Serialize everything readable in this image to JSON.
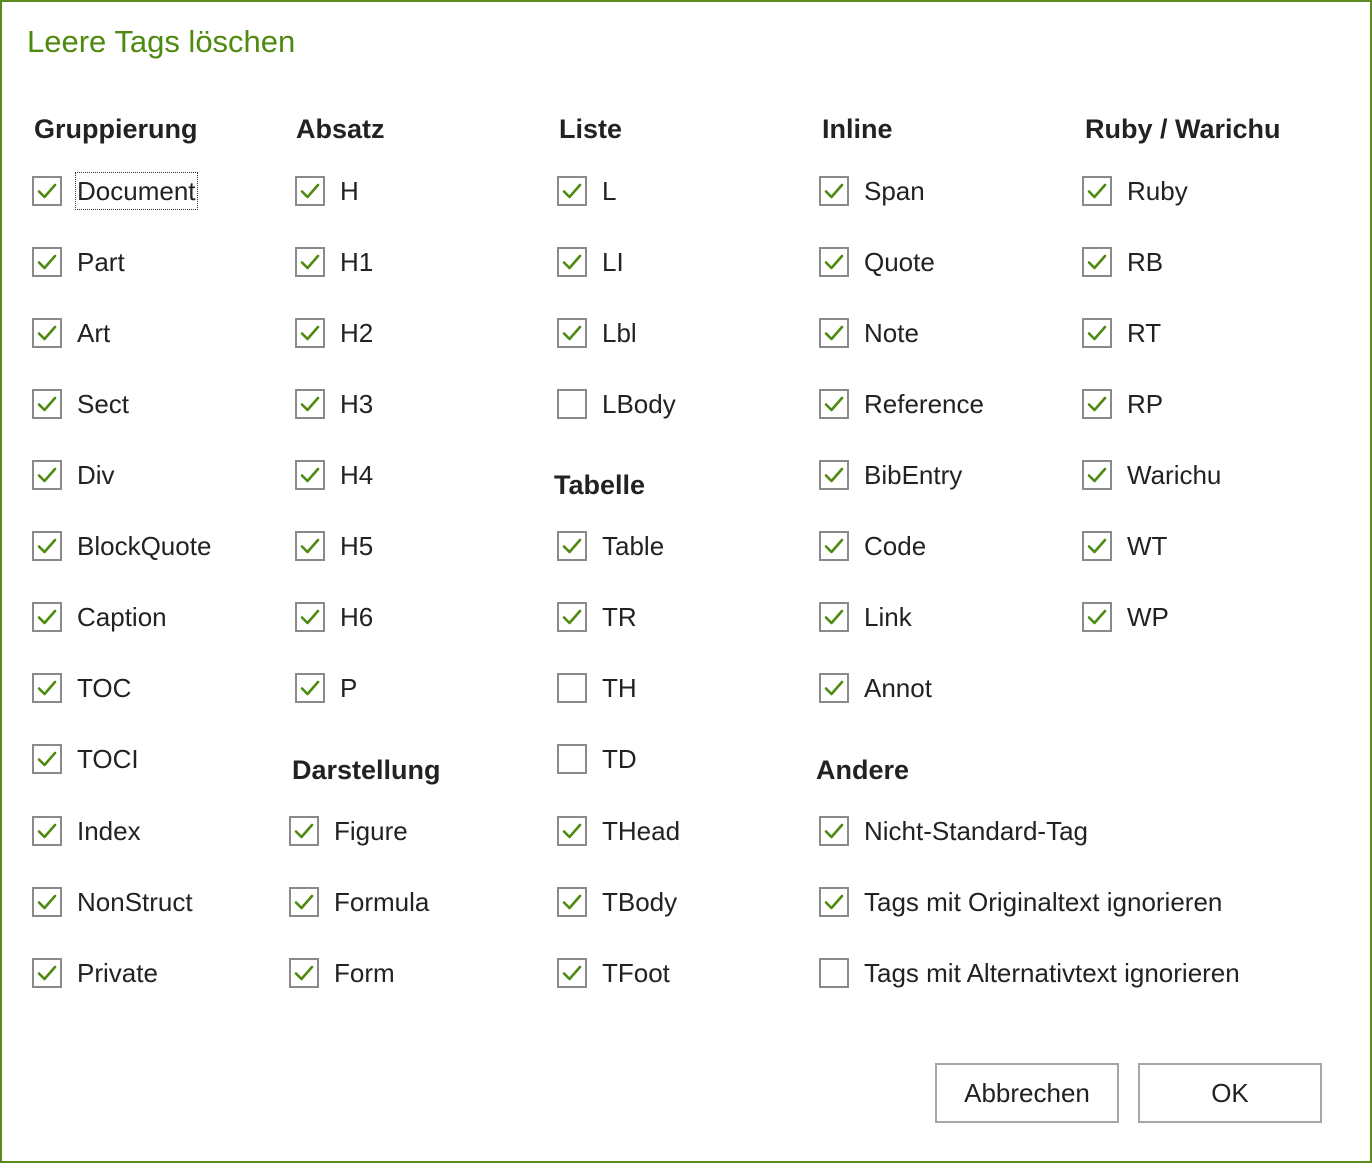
{
  "dialog": {
    "title": "Leere Tags löschen"
  },
  "headings": {
    "gruppierung": "Gruppierung",
    "absatz": "Absatz",
    "liste": "Liste",
    "inline": "Inline",
    "ruby": "Ruby / Warichu",
    "tabelle": "Tabelle",
    "darstellung": "Darstellung",
    "andere": "Andere"
  },
  "columns": {
    "gruppierung": [
      {
        "label": "Document",
        "checked": true
      },
      {
        "label": "Part",
        "checked": true
      },
      {
        "label": "Art",
        "checked": true
      },
      {
        "label": "Sect",
        "checked": true
      },
      {
        "label": "Div",
        "checked": true
      },
      {
        "label": "BlockQuote",
        "checked": true
      },
      {
        "label": "Caption",
        "checked": true
      },
      {
        "label": "TOC",
        "checked": true
      },
      {
        "label": "TOCI",
        "checked": true
      },
      {
        "label": "Index",
        "checked": true
      },
      {
        "label": "NonStruct",
        "checked": true
      },
      {
        "label": "Private",
        "checked": true
      }
    ],
    "absatz": [
      {
        "label": "H",
        "checked": true
      },
      {
        "label": "H1",
        "checked": true
      },
      {
        "label": "H2",
        "checked": true
      },
      {
        "label": "H3",
        "checked": true
      },
      {
        "label": "H4",
        "checked": true
      },
      {
        "label": "H5",
        "checked": true
      },
      {
        "label": "H6",
        "checked": true
      },
      {
        "label": "P",
        "checked": true
      }
    ],
    "darstellung": [
      {
        "label": "Figure",
        "checked": true
      },
      {
        "label": "Formula",
        "checked": true
      },
      {
        "label": "Form",
        "checked": true
      }
    ],
    "liste": [
      {
        "label": "L",
        "checked": true
      },
      {
        "label": "LI",
        "checked": true
      },
      {
        "label": "Lbl",
        "checked": true
      },
      {
        "label": "LBody",
        "checked": false
      }
    ],
    "tabelle": [
      {
        "label": "Table",
        "checked": true
      },
      {
        "label": "TR",
        "checked": true
      },
      {
        "label": "TH",
        "checked": false
      },
      {
        "label": "TD",
        "checked": false
      },
      {
        "label": "THead",
        "checked": true
      },
      {
        "label": "TBody",
        "checked": true
      },
      {
        "label": "TFoot",
        "checked": true
      }
    ],
    "inline": [
      {
        "label": "Span",
        "checked": true
      },
      {
        "label": "Quote",
        "checked": true
      },
      {
        "label": "Note",
        "checked": true
      },
      {
        "label": "Reference",
        "checked": true
      },
      {
        "label": "BibEntry",
        "checked": true
      },
      {
        "label": "Code",
        "checked": true
      },
      {
        "label": "Link",
        "checked": true
      },
      {
        "label": "Annot",
        "checked": true
      }
    ],
    "andere": [
      {
        "label": "Nicht-Standard-Tag",
        "checked": true
      },
      {
        "label": "Tags mit Originaltext ignorieren",
        "checked": true
      },
      {
        "label": "Tags mit Alternativtext ignorieren",
        "checked": false
      }
    ],
    "ruby": [
      {
        "label": "Ruby",
        "checked": true
      },
      {
        "label": "RB",
        "checked": true
      },
      {
        "label": "RT",
        "checked": true
      },
      {
        "label": "RP",
        "checked": true
      },
      {
        "label": "Warichu",
        "checked": true
      },
      {
        "label": "WT",
        "checked": true
      },
      {
        "label": "WP",
        "checked": true
      }
    ]
  },
  "buttons": {
    "cancel": "Abbrechen",
    "ok": "OK"
  },
  "colors": {
    "accent": "#4f8a10",
    "check": "#4f8a10",
    "border": "#5b8a1e"
  },
  "icons": {
    "check": "checkmark-icon"
  }
}
